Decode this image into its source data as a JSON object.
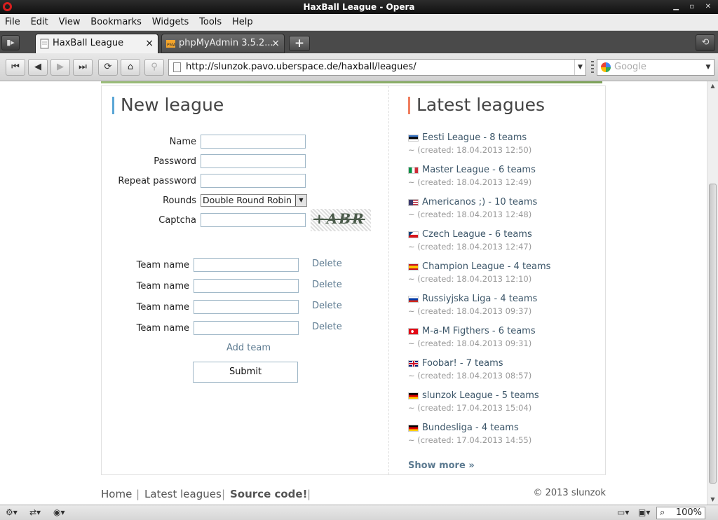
{
  "window": {
    "title": "HaxBall League - Opera"
  },
  "menu": {
    "items": [
      "File",
      "Edit",
      "View",
      "Bookmarks",
      "Widgets",
      "Tools",
      "Help"
    ]
  },
  "tabs": [
    {
      "label": "HaxBall League",
      "active": true
    },
    {
      "label": "phpMyAdmin 3.5.2...",
      "active": false
    }
  ],
  "nav": {
    "url": "http://slunzok.pavo.uberspace.de/haxball/leagues/",
    "search_placeholder": "Google"
  },
  "new_league": {
    "title": "New league",
    "labels": {
      "name": "Name",
      "password": "Password",
      "repeat": "Repeat password",
      "rounds": "Rounds",
      "captcha": "Captcha"
    },
    "rounds_selected": "Double Round Robin",
    "captcha_text": "+ABR",
    "team_label": "Team name",
    "delete_label": "Delete",
    "add_team": "Add team",
    "submit": "Submit"
  },
  "latest": {
    "title": "Latest leagues",
    "items": [
      {
        "name": "Eesti League - 8 teams",
        "created": "~ (created: 18.04.2013 12:50)",
        "flag": "estonia"
      },
      {
        "name": "Master League - 6 teams",
        "created": "~ (created: 18.04.2013 12:49)",
        "flag": "italy"
      },
      {
        "name": "Americanos ;) - 10 teams",
        "created": "~ (created: 18.04.2013 12:48)",
        "flag": "usa"
      },
      {
        "name": "Czech League - 6 teams",
        "created": "~ (created: 18.04.2013 12:47)",
        "flag": "czech"
      },
      {
        "name": "Champion League - 4 teams",
        "created": "~ (created: 18.04.2013 12:10)",
        "flag": "spain"
      },
      {
        "name": "Russiyjska Liga - 4 teams",
        "created": "~ (created: 18.04.2013 09:37)",
        "flag": "russia"
      },
      {
        "name": "M-a-M Figthers - 6 teams",
        "created": "~ (created: 18.04.2013 09:31)",
        "flag": "turkey"
      },
      {
        "name": "Foobar! - 7 teams",
        "created": "~ (created: 18.04.2013 08:57)",
        "flag": "uk"
      },
      {
        "name": "slunzok League - 5 teams",
        "created": "~ (created: 17.04.2013 15:04)",
        "flag": "germany"
      },
      {
        "name": "Bundesliga - 4 teams",
        "created": "~ (created: 17.04.2013 14:55)",
        "flag": "germany"
      }
    ],
    "show_more": "Show more »"
  },
  "footer": {
    "links": [
      "Home",
      "Latest leagues",
      "Source code!"
    ],
    "separator": "|",
    "copyright": "© 2013 slunzok"
  },
  "status": {
    "zoom": "100%"
  }
}
